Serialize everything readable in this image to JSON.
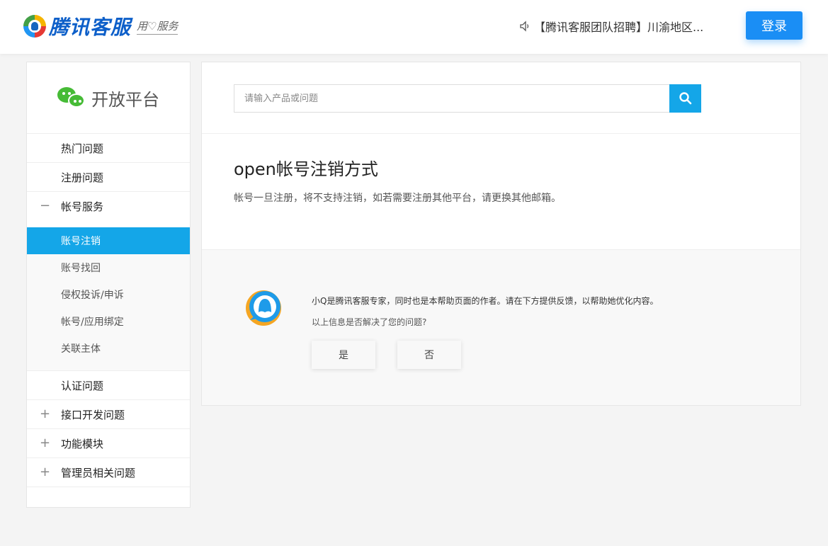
{
  "header": {
    "logo_text": "腾讯客服",
    "logo_slogan": "用♡服务",
    "notice": "【腾讯客服团队招聘】川渝地区...",
    "login_label": "登录"
  },
  "sidebar": {
    "brand": "开放平台",
    "items": [
      {
        "label": "热门问题"
      },
      {
        "label": "注册问题"
      },
      {
        "label": "帐号服务",
        "toggle": "−"
      },
      {
        "label": "认证问题"
      },
      {
        "label": "接口开发问题",
        "toggle": "+"
      },
      {
        "label": "功能模块",
        "toggle": "+"
      },
      {
        "label": "管理员相关问题",
        "toggle": "+"
      }
    ],
    "subitems": [
      {
        "label": "账号注销"
      },
      {
        "label": "账号找回"
      },
      {
        "label": "侵权投诉/申诉"
      },
      {
        "label": "帐号/应用绑定"
      },
      {
        "label": "关联主体"
      }
    ]
  },
  "search": {
    "placeholder": "请输入产品或问题"
  },
  "article": {
    "title": "open帐号注销方式",
    "body": "帐号一旦注册，将不支持注销，如若需要注册其他平台，请更换其他邮箱。"
  },
  "feedback": {
    "intro": "小Q是腾讯客服专家，同时也是本帮助页面的作者。请在下方提供反馈，以帮助她优化内容。",
    "question": "以上信息是否解决了您的问题?",
    "yes_label": "是",
    "no_label": "否"
  },
  "colors": {
    "accent": "#14a6e8",
    "login": "#1a8ef5",
    "wechat": "#46bb36"
  }
}
